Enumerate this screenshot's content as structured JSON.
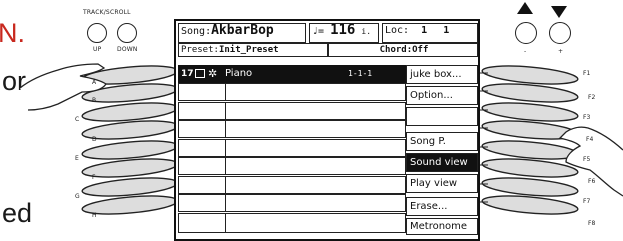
{
  "edge_text": {
    "left_top": "N.",
    "left_mid": "or",
    "left_bottom": "ed"
  },
  "panel": {
    "track_scroll": "TRACK/SCROLL",
    "up": "UP",
    "down": "DOWN",
    "minus": "-",
    "plus": "+"
  },
  "left_buttons": [
    "A",
    "B",
    "C",
    "D",
    "E",
    "F",
    "G",
    "H"
  ],
  "right_buttons": [
    "F1",
    "F2",
    "F3",
    "F4",
    "F5",
    "F6",
    "F7",
    "F8"
  ],
  "display": {
    "song_label": "Song:",
    "song_name": "AkbarBop",
    "tempo_symbol": "♩=",
    "tempo_value": "116",
    "tempo_suffix": "i.",
    "loc_label": "Loc:",
    "loc_bar": "1",
    "loc_beat": "1",
    "preset_label": "Preset:",
    "preset_name": "Init_Preset",
    "chord_label": "Chord:",
    "chord_value": "Off",
    "track": {
      "number": "17",
      "name": "Piano",
      "position": "1-1-1"
    },
    "menu": [
      {
        "label": "juke box..."
      },
      {
        "label": "Option..."
      },
      {
        "label": ""
      },
      {
        "label": "Song P."
      },
      {
        "label": "Sound view"
      },
      {
        "label": "Play view"
      },
      {
        "label": "Erase..."
      },
      {
        "label": "Metronome"
      }
    ]
  }
}
